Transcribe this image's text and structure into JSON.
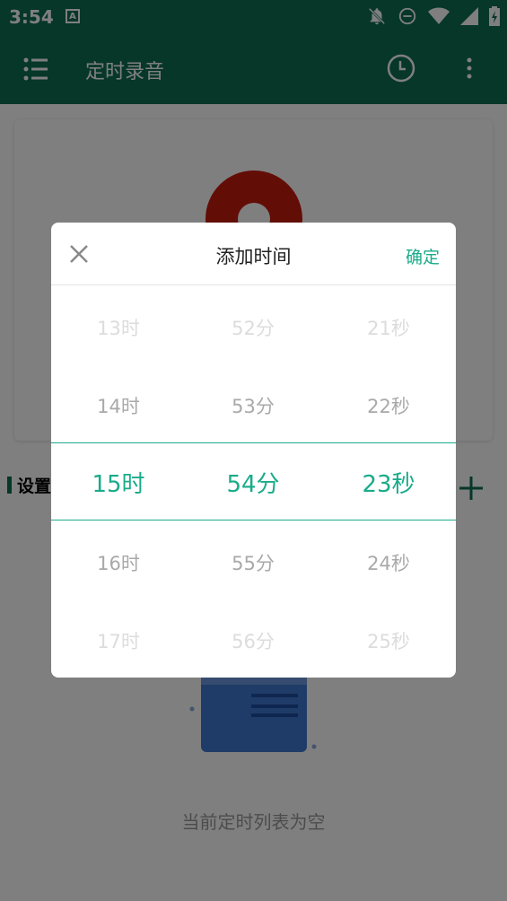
{
  "status_bar": {
    "time": "3:54",
    "app_icon_letter": "A"
  },
  "toolbar": {
    "title": "定时录音"
  },
  "section": {
    "settings_label": "设置"
  },
  "empty_state": {
    "text": "当前定时列表为空"
  },
  "dialog": {
    "title": "添加时间",
    "confirm_label": "确定",
    "hours": [
      "13时",
      "14时",
      "15时",
      "16时",
      "17时"
    ],
    "minutes": [
      "52分",
      "53分",
      "54分",
      "55分",
      "56分"
    ],
    "seconds": [
      "21秒",
      "22秒",
      "23秒",
      "24秒",
      "25秒"
    ]
  },
  "colors": {
    "primary": "#0d6f53",
    "accent": "#1aab8a",
    "record": "#c61a0f"
  },
  "icons": [
    "menu-icon",
    "clock-icon",
    "more-vert-icon",
    "close-icon",
    "add-icon",
    "notifications-off-icon",
    "dnd-icon",
    "wifi-icon",
    "signal-icon",
    "battery-icon"
  ]
}
